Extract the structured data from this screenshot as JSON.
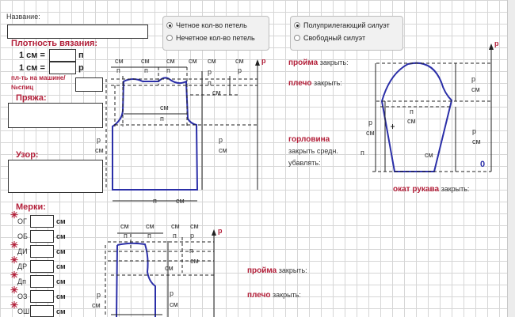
{
  "header": {
    "name_label": "Название:"
  },
  "density": {
    "title": "Плотность вязания:",
    "row1_prefix": "1 см =",
    "row1_unit": "п",
    "row2_prefix": "1 см =",
    "row2_unit": "р",
    "machine_label_1": "пл-ть на машине/",
    "machine_label_2": "№спиц"
  },
  "yarn_label": "Пряжа:",
  "pattern_label": "Узор:",
  "measures": {
    "title": "Мерки:",
    "items": [
      "ОГ",
      "ОБ",
      "ДИ",
      "ДР",
      "Дп",
      "ОЗ",
      "ОШ"
    ],
    "unit": "см"
  },
  "stitch_options": [
    {
      "label": "Четное кол-во петель",
      "selected": true
    },
    {
      "label": "Нечетное кол-во петель",
      "selected": false
    }
  ],
  "fit_options": [
    {
      "label": "Полуприлегающий силуэт",
      "selected": true
    },
    {
      "label": "Свободный силуэт",
      "selected": false
    }
  ],
  "body": {
    "armhole_title": "пройма",
    "armhole_close": "закрыть:",
    "shoulder_title": "плечо",
    "shoulder_close": "закрыть:",
    "neck_title": "горловина",
    "neck_line1": "закрыть средн.",
    "neck_line2": "убавлять:",
    "sleeve_cap_title": "окат рукава",
    "sleeve_cap_close": "закрыть:",
    "sleeve_value": "0"
  },
  "units": {
    "cm": "см",
    "p": "п",
    "r": "р"
  },
  "colors": {
    "accent": "#b3203a",
    "pattern_line": "#2b2fa8"
  }
}
